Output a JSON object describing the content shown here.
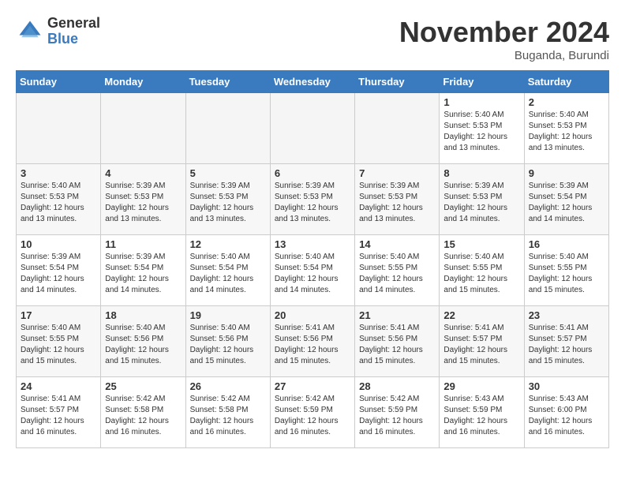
{
  "logo": {
    "general": "General",
    "blue": "Blue"
  },
  "title": "November 2024",
  "location": "Buganda, Burundi",
  "days_header": [
    "Sunday",
    "Monday",
    "Tuesday",
    "Wednesday",
    "Thursday",
    "Friday",
    "Saturday"
  ],
  "weeks": [
    {
      "shade": "odd",
      "days": [
        {
          "num": "",
          "info": "",
          "empty": true
        },
        {
          "num": "",
          "info": "",
          "empty": true
        },
        {
          "num": "",
          "info": "",
          "empty": true
        },
        {
          "num": "",
          "info": "",
          "empty": true
        },
        {
          "num": "",
          "info": "",
          "empty": true
        },
        {
          "num": "1",
          "info": "Sunrise: 5:40 AM\nSunset: 5:53 PM\nDaylight: 12 hours\nand 13 minutes.",
          "empty": false
        },
        {
          "num": "2",
          "info": "Sunrise: 5:40 AM\nSunset: 5:53 PM\nDaylight: 12 hours\nand 13 minutes.",
          "empty": false
        }
      ]
    },
    {
      "shade": "even",
      "days": [
        {
          "num": "3",
          "info": "Sunrise: 5:40 AM\nSunset: 5:53 PM\nDaylight: 12 hours\nand 13 minutes.",
          "empty": false
        },
        {
          "num": "4",
          "info": "Sunrise: 5:39 AM\nSunset: 5:53 PM\nDaylight: 12 hours\nand 13 minutes.",
          "empty": false
        },
        {
          "num": "5",
          "info": "Sunrise: 5:39 AM\nSunset: 5:53 PM\nDaylight: 12 hours\nand 13 minutes.",
          "empty": false
        },
        {
          "num": "6",
          "info": "Sunrise: 5:39 AM\nSunset: 5:53 PM\nDaylight: 12 hours\nand 13 minutes.",
          "empty": false
        },
        {
          "num": "7",
          "info": "Sunrise: 5:39 AM\nSunset: 5:53 PM\nDaylight: 12 hours\nand 13 minutes.",
          "empty": false
        },
        {
          "num": "8",
          "info": "Sunrise: 5:39 AM\nSunset: 5:53 PM\nDaylight: 12 hours\nand 14 minutes.",
          "empty": false
        },
        {
          "num": "9",
          "info": "Sunrise: 5:39 AM\nSunset: 5:54 PM\nDaylight: 12 hours\nand 14 minutes.",
          "empty": false
        }
      ]
    },
    {
      "shade": "odd",
      "days": [
        {
          "num": "10",
          "info": "Sunrise: 5:39 AM\nSunset: 5:54 PM\nDaylight: 12 hours\nand 14 minutes.",
          "empty": false
        },
        {
          "num": "11",
          "info": "Sunrise: 5:39 AM\nSunset: 5:54 PM\nDaylight: 12 hours\nand 14 minutes.",
          "empty": false
        },
        {
          "num": "12",
          "info": "Sunrise: 5:40 AM\nSunset: 5:54 PM\nDaylight: 12 hours\nand 14 minutes.",
          "empty": false
        },
        {
          "num": "13",
          "info": "Sunrise: 5:40 AM\nSunset: 5:54 PM\nDaylight: 12 hours\nand 14 minutes.",
          "empty": false
        },
        {
          "num": "14",
          "info": "Sunrise: 5:40 AM\nSunset: 5:55 PM\nDaylight: 12 hours\nand 14 minutes.",
          "empty": false
        },
        {
          "num": "15",
          "info": "Sunrise: 5:40 AM\nSunset: 5:55 PM\nDaylight: 12 hours\nand 15 minutes.",
          "empty": false
        },
        {
          "num": "16",
          "info": "Sunrise: 5:40 AM\nSunset: 5:55 PM\nDaylight: 12 hours\nand 15 minutes.",
          "empty": false
        }
      ]
    },
    {
      "shade": "even",
      "days": [
        {
          "num": "17",
          "info": "Sunrise: 5:40 AM\nSunset: 5:55 PM\nDaylight: 12 hours\nand 15 minutes.",
          "empty": false
        },
        {
          "num": "18",
          "info": "Sunrise: 5:40 AM\nSunset: 5:56 PM\nDaylight: 12 hours\nand 15 minutes.",
          "empty": false
        },
        {
          "num": "19",
          "info": "Sunrise: 5:40 AM\nSunset: 5:56 PM\nDaylight: 12 hours\nand 15 minutes.",
          "empty": false
        },
        {
          "num": "20",
          "info": "Sunrise: 5:41 AM\nSunset: 5:56 PM\nDaylight: 12 hours\nand 15 minutes.",
          "empty": false
        },
        {
          "num": "21",
          "info": "Sunrise: 5:41 AM\nSunset: 5:56 PM\nDaylight: 12 hours\nand 15 minutes.",
          "empty": false
        },
        {
          "num": "22",
          "info": "Sunrise: 5:41 AM\nSunset: 5:57 PM\nDaylight: 12 hours\nand 15 minutes.",
          "empty": false
        },
        {
          "num": "23",
          "info": "Sunrise: 5:41 AM\nSunset: 5:57 PM\nDaylight: 12 hours\nand 15 minutes.",
          "empty": false
        }
      ]
    },
    {
      "shade": "odd",
      "days": [
        {
          "num": "24",
          "info": "Sunrise: 5:41 AM\nSunset: 5:57 PM\nDaylight: 12 hours\nand 16 minutes.",
          "empty": false
        },
        {
          "num": "25",
          "info": "Sunrise: 5:42 AM\nSunset: 5:58 PM\nDaylight: 12 hours\nand 16 minutes.",
          "empty": false
        },
        {
          "num": "26",
          "info": "Sunrise: 5:42 AM\nSunset: 5:58 PM\nDaylight: 12 hours\nand 16 minutes.",
          "empty": false
        },
        {
          "num": "27",
          "info": "Sunrise: 5:42 AM\nSunset: 5:59 PM\nDaylight: 12 hours\nand 16 minutes.",
          "empty": false
        },
        {
          "num": "28",
          "info": "Sunrise: 5:42 AM\nSunset: 5:59 PM\nDaylight: 12 hours\nand 16 minutes.",
          "empty": false
        },
        {
          "num": "29",
          "info": "Sunrise: 5:43 AM\nSunset: 5:59 PM\nDaylight: 12 hours\nand 16 minutes.",
          "empty": false
        },
        {
          "num": "30",
          "info": "Sunrise: 5:43 AM\nSunset: 6:00 PM\nDaylight: 12 hours\nand 16 minutes.",
          "empty": false
        }
      ]
    }
  ]
}
